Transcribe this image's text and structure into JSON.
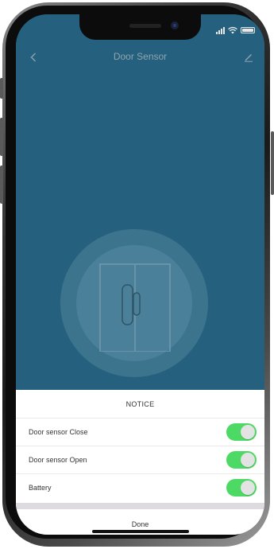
{
  "colors": {
    "app_background": "#25617f",
    "toggle_on": "#4cd964",
    "sheet_background": "#ffffff",
    "nav_text": "#8ea3ad"
  },
  "status_bar": {
    "icons": [
      "signal-icon",
      "wifi-icon",
      "battery-icon"
    ]
  },
  "navbar": {
    "title": "Door Sensor",
    "back_icon": "chevron-left-icon",
    "edit_icon": "pencil-icon"
  },
  "device": {
    "illustration_icon": "door-sensor-icon"
  },
  "sheet": {
    "title": "NOTICE",
    "items": [
      {
        "label": "Door sensor Close",
        "enabled": true
      },
      {
        "label": "Door sensor Open",
        "enabled": true
      },
      {
        "label": "Battery",
        "enabled": true
      }
    ],
    "done_label": "Done"
  }
}
